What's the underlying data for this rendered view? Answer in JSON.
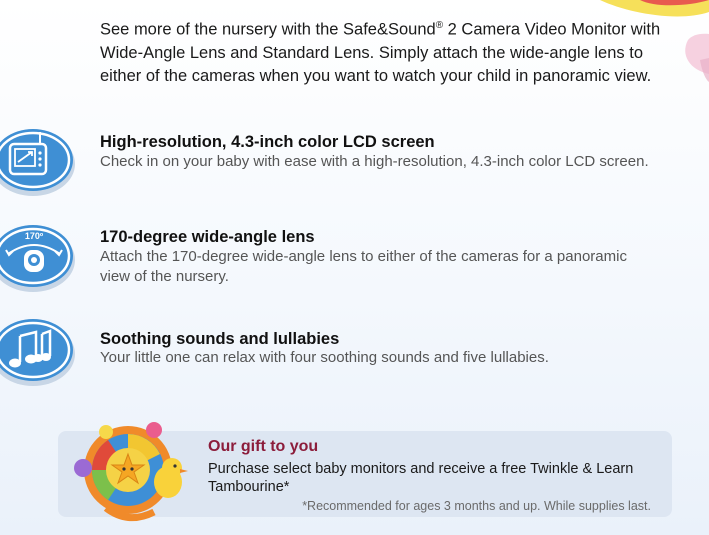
{
  "intro": {
    "part1": "See more of the nursery with the Safe&Sound",
    "reg": "®",
    "part2": " 2 Camera Video Monitor with Wide-Angle Lens and Standard Lens. Simply attach the wide-angle lens to either of the cameras when you want to watch your child in panoramic view."
  },
  "features": [
    {
      "icon": "lcd-screen-icon",
      "title": "High-resolution, 4.3-inch color LCD screen",
      "desc": "Check in on your baby with ease with a high-resolution, 4.3-inch color LCD screen."
    },
    {
      "icon": "wide-angle-camera-icon",
      "icon_label": "170º",
      "title": "170-degree wide-angle lens",
      "desc": "Attach the 170-degree wide-angle lens to either of the cameras for a panoramic view of the nursery."
    },
    {
      "icon": "music-notes-icon",
      "title": "Soothing sounds and lullabies",
      "desc": "Your little one can relax with four soothing sounds and five lullabies."
    }
  ],
  "gift": {
    "title": "Our gift to you",
    "text": "Purchase select baby monitors and receive a free Twinkle & Learn Tambourine*",
    "note": "*Recommended for ages 3 months and up. While supplies last.",
    "image": "tambourine-toy-image"
  },
  "colors": {
    "icon_blue": "#3f8fd4",
    "gift_title": "#8c1d3b",
    "gift_bg": "#dde6f2"
  }
}
